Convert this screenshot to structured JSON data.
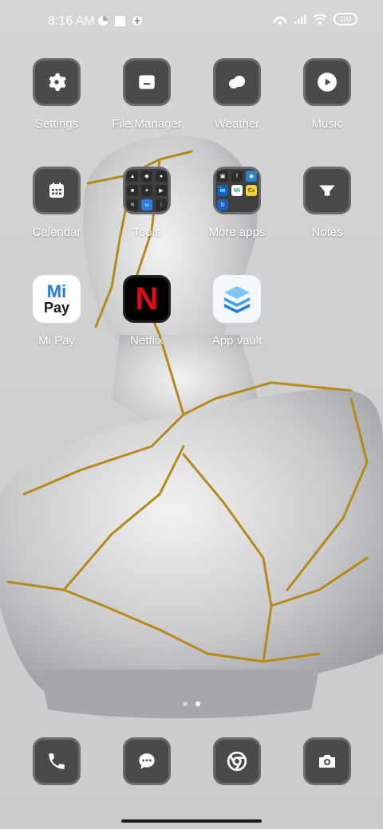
{
  "status_bar": {
    "time": "8:16 AM",
    "battery": "100",
    "icons": [
      "notification-icon",
      "square-icon",
      "notification-icon",
      "hotspot-icon",
      "signal-icon",
      "wifi-icon"
    ]
  },
  "home": {
    "apps": [
      {
        "label": "Settings",
        "icon": "gear-icon"
      },
      {
        "label": "File Manager",
        "icon": "folder-icon"
      },
      {
        "label": "Weather",
        "icon": "cloud-icon"
      },
      {
        "label": "Music",
        "icon": "play-icon"
      },
      {
        "label": "Calendar",
        "icon": "calendar-icon"
      },
      {
        "label": "Tools",
        "icon": "folder-icon"
      },
      {
        "label": "More apps",
        "icon": "folder-icon"
      },
      {
        "label": "Notes",
        "icon": "notes-icon"
      },
      {
        "label": "Mi Pay",
        "icon": "mi-pay-icon"
      },
      {
        "label": "Netflix",
        "icon": "netflix-icon"
      },
      {
        "label": "App vault",
        "icon": "app-vault-icon"
      }
    ],
    "mipay_text": {
      "top": "Mi",
      "bottom": "Pay"
    },
    "netflix_letter": "N",
    "more_apps_tiles": [
      "in",
      "Mi",
      "Ex"
    ]
  },
  "dock": [
    {
      "icon": "phone-icon"
    },
    {
      "icon": "messages-icon"
    },
    {
      "icon": "chrome-icon"
    },
    {
      "icon": "camera-icon"
    }
  ],
  "page_indicator": {
    "pages": 2,
    "current": 2
  }
}
